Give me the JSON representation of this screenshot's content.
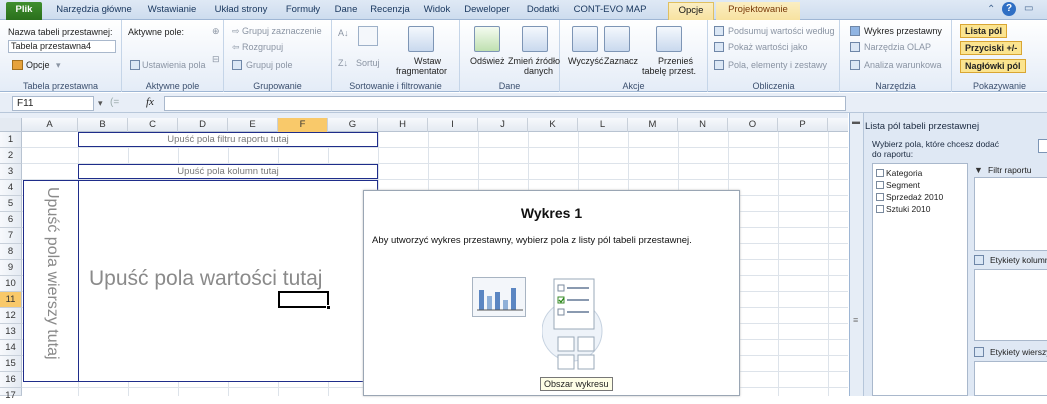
{
  "tabs": [
    "Plik",
    "Narzędzia główne",
    "Wstawianie",
    "Układ strony",
    "Formuły",
    "Dane",
    "Recenzja",
    "Widok",
    "Deweloper",
    "Dodatki",
    "CONT-EVO MAP",
    "Opcje",
    "Projektowanie"
  ],
  "active_tab": "Opcje",
  "window_controls": {
    "minimize_icon": "caret-up-icon",
    "help": "?",
    "restore": "▭"
  },
  "ribbon": {
    "pivot": {
      "name_label": "Nazwa tabeli przestawnej:",
      "name_value": "Tabela przestawna4",
      "options": "Opcje",
      "group": "Tabela przestawna"
    },
    "active_field": {
      "label": "Aktywne pole:",
      "settings": "Ustawienia pola",
      "group": "Aktywne pole"
    },
    "grouping": {
      "group_sel": "Grupuj zaznaczenie",
      "ungroup": "Rozgrupuj",
      "group_field": "Grupuj pole",
      "group": "Grupowanie"
    },
    "sort": {
      "sort": "Sortuj",
      "slicer_1": "Wstaw",
      "slicer_2": "fragmentator",
      "group": "Sortowanie i filtrowanie"
    },
    "data": {
      "refresh": "Odśwież",
      "change_1": "Zmień źródło",
      "change_2": "danych",
      "group": "Dane"
    },
    "actions": {
      "clear": "Wyczyść",
      "select": "Zaznacz",
      "move_1": "Przenieś",
      "move_2": "tabelę przest.",
      "group": "Akcje"
    },
    "calc": {
      "summarize": "Podsumuj wartości według",
      "show_as": "Pokaż wartości jako",
      "fields": "Pola, elementy i zestawy",
      "group": "Obliczenia"
    },
    "tools": {
      "chart": "Wykres przestawny",
      "olap": "Narzędzia OLAP",
      "whatif": "Analiza warunkowa",
      "group": "Narzędzia"
    },
    "show": {
      "field_list": "Lista pól",
      "buttons": "Przyciski +/-",
      "headers": "Nagłówki pól",
      "group": "Pokazywanie"
    }
  },
  "formula_bar": {
    "name_box": "F11",
    "fx": "fx"
  },
  "columns": [
    "A",
    "B",
    "C",
    "D",
    "E",
    "F",
    "G",
    "H",
    "I",
    "J",
    "K",
    "L",
    "M",
    "N",
    "O",
    "P"
  ],
  "rows": [
    "1",
    "2",
    "3",
    "4",
    "5",
    "6",
    "7",
    "8",
    "9",
    "10",
    "11",
    "12",
    "13",
    "14",
    "15",
    "16",
    "17"
  ],
  "pivot_area": {
    "report_filter": "Upuść pola filtru raportu tutaj",
    "column_fields": "Upuść pola kolumn tutaj",
    "row_fields": "Upuść pola wierszy tutaj",
    "values": "Upuść pola wartości tutaj"
  },
  "chart": {
    "title": "Wykres 1",
    "message": "Aby utworzyć wykres przestawny, wybierz pola z listy pól tabeli przestawnej.",
    "tooltip": "Obszar wykresu"
  },
  "field_list": {
    "title": "Lista pól tabeli przestawnej",
    "prompt": "Wybierz pola, które chcesz dodać do raportu:",
    "fields": [
      "Kategoria",
      "Segment",
      "Sprzedaż 2010",
      "Sztuki 2010"
    ],
    "filter_label": "Filtr raportu",
    "col_label": "Etykiety kolumn",
    "row_label": "Etykiety wierszy"
  },
  "colors": {
    "accent": "#2a6f1c",
    "selection": "#f9c96a",
    "pivot_border": "#1f2d8a"
  }
}
